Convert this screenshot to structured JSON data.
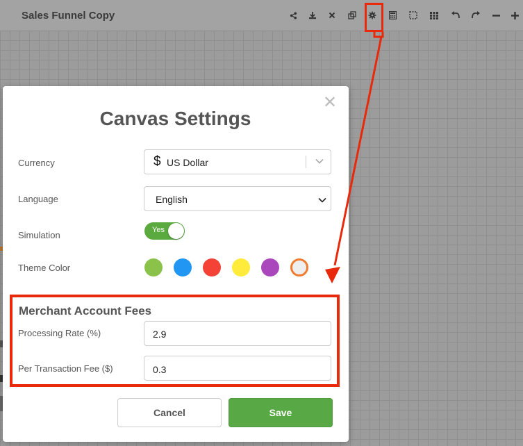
{
  "app": {
    "title": "Sales Funnel Copy"
  },
  "toolbar": {
    "icons": [
      "share-icon",
      "download-icon",
      "close-icon",
      "copy-icon",
      "gear-icon",
      "calculator-icon",
      "select-area-icon",
      "grid-icon",
      "undo-icon",
      "redo-icon",
      "zoom-out-icon",
      "zoom-in-icon"
    ]
  },
  "modal": {
    "title": "Canvas Settings",
    "close_glyph": "✕",
    "currency": {
      "label": "Currency",
      "symbol": "$",
      "value": "US Dollar"
    },
    "language": {
      "label": "Language",
      "value": "English",
      "options": [
        "English"
      ]
    },
    "simulation": {
      "label": "Simulation",
      "toggle_text": "Yes",
      "enabled": true
    },
    "theme": {
      "label": "Theme Color",
      "swatches": [
        "#8bc34a",
        "#2196f3",
        "#f44336",
        "#ffeb3b",
        "#ab47bc",
        "#eeeeee"
      ],
      "selected_index": 5
    },
    "merchant": {
      "title": "Merchant Account Fees",
      "processing_rate": {
        "label": "Processing Rate (%)",
        "value": "2.9"
      },
      "per_transaction_fee": {
        "label": "Per Transaction Fee ($)",
        "value": "0.3"
      }
    },
    "buttons": {
      "cancel": "Cancel",
      "save": "Save"
    }
  },
  "annotation": {
    "color": "#e8290b"
  }
}
